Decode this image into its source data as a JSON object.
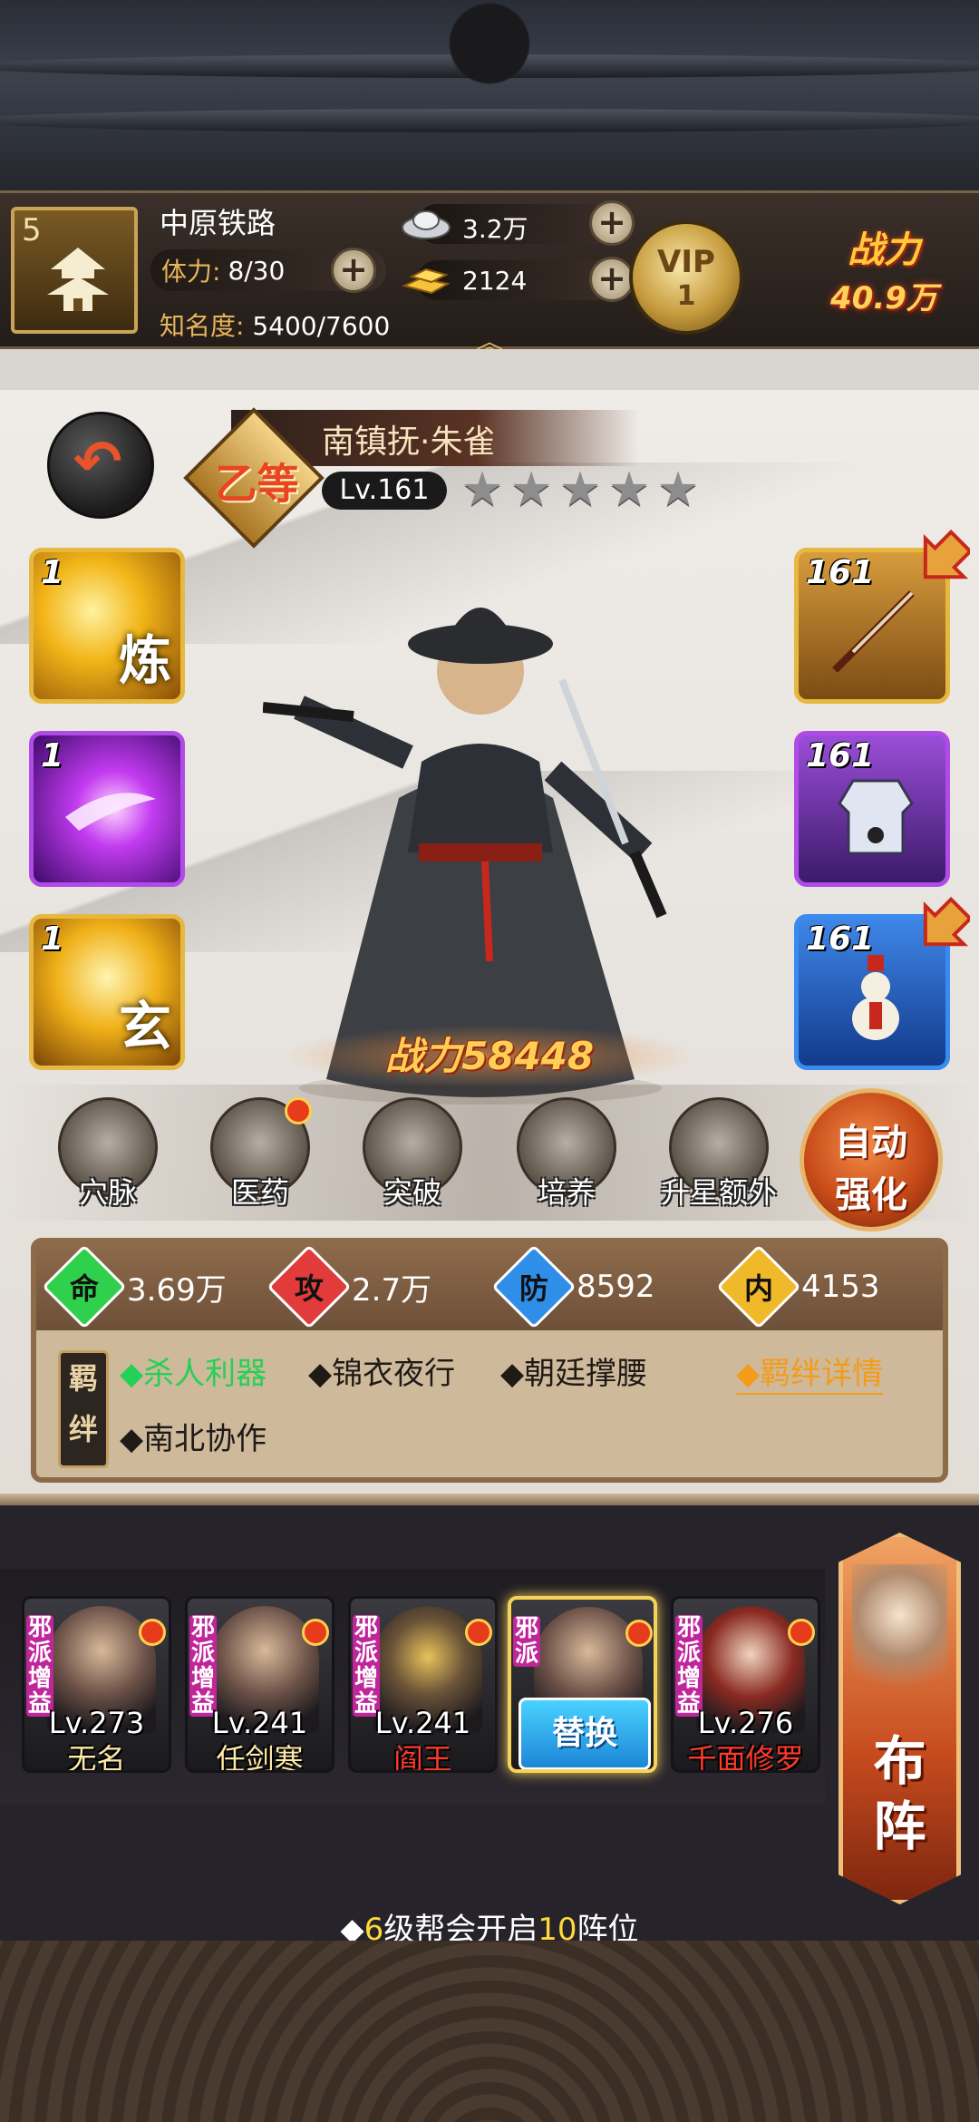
{
  "player": {
    "level": "5",
    "name": "中原铁路",
    "stamina_label": "体力:",
    "stamina_value": "8/30",
    "fame_label": "知名度:",
    "fame_value": "5400/7600",
    "silver": "3.2万",
    "gold": "2124",
    "vip_label": "VIP",
    "vip_level": "1",
    "power_label": "战力",
    "power_value": "40.9万"
  },
  "hero": {
    "grade": "乙等",
    "name": "南镇抚·朱雀",
    "level": "Lv.161",
    "stars_total": 5,
    "stars_filled": 0,
    "power": "战力58448",
    "left_slots": [
      {
        "level": "1",
        "glyph": "炼",
        "color": "#f0b92a"
      },
      {
        "level": "1",
        "glyph": "",
        "color": "#a82ff0"
      },
      {
        "level": "1",
        "glyph": "玄",
        "color": "#f0b92a"
      }
    ],
    "right_slots": [
      {
        "level": "161",
        "item": "sword-icon",
        "upgrade": true
      },
      {
        "level": "161",
        "item": "armor-icon",
        "upgrade": false
      },
      {
        "level": "161",
        "item": "gourd-icon",
        "upgrade": true
      }
    ]
  },
  "functions": [
    {
      "label": "穴脉",
      "icon": "meridian-icon",
      "dot": false
    },
    {
      "label": "医药",
      "icon": "medicine-icon",
      "dot": true
    },
    {
      "label": "突破",
      "icon": "breakthrough-icon",
      "dot": false
    },
    {
      "label": "培养",
      "icon": "cultivate-icon",
      "dot": false
    },
    {
      "label": "升星额外",
      "icon": "star-up-icon",
      "dot": false
    }
  ],
  "auto_enhance": {
    "line1": "自动",
    "line2": "强化"
  },
  "attributes": [
    {
      "key": "命",
      "value": "3.69万",
      "color": "#2fd04c"
    },
    {
      "key": "攻",
      "value": "2.7万",
      "color": "#e23b3b"
    },
    {
      "key": "防",
      "value": "8592",
      "color": "#2f8ee8"
    },
    {
      "key": "内",
      "value": "4153",
      "color": "#f0b92a"
    }
  ],
  "bonds": {
    "tag": "羁绊",
    "items": [
      {
        "text": "◆杀人利器",
        "active": true
      },
      {
        "text": "◆锦衣夜行",
        "active": false
      },
      {
        "text": "◆朝廷撑腰",
        "active": false
      },
      {
        "text": "◆南北协作",
        "active": false
      }
    ],
    "detail_link": "◆羁绊详情"
  },
  "team": [
    {
      "faction": "邪派增益",
      "level": "Lv.273",
      "name": "无名",
      "name_color": "#ffe9a8",
      "current": false
    },
    {
      "faction": "邪派增益",
      "level": "Lv.241",
      "name": "任剑寒",
      "name_color": "#ffe9a8",
      "current": false
    },
    {
      "faction": "邪派增益",
      "level": "Lv.241",
      "name": "阎王",
      "name_color": "#ff3a2a",
      "current": false
    },
    {
      "faction": "邪派",
      "level": "",
      "name": "",
      "name_color": "#ffffff",
      "current": true,
      "swap_label": "替换"
    },
    {
      "faction": "邪派增益",
      "level": "Lv.276",
      "name": "千面修罗",
      "name_color": "#ff3a2a",
      "current": false
    }
  ],
  "formation": {
    "line1": "布",
    "line2": "阵"
  },
  "team_tip": {
    "prefix": "◆",
    "num1": "6",
    "mid": "级帮会开启",
    "num2": "10",
    "suffix": "阵位"
  }
}
